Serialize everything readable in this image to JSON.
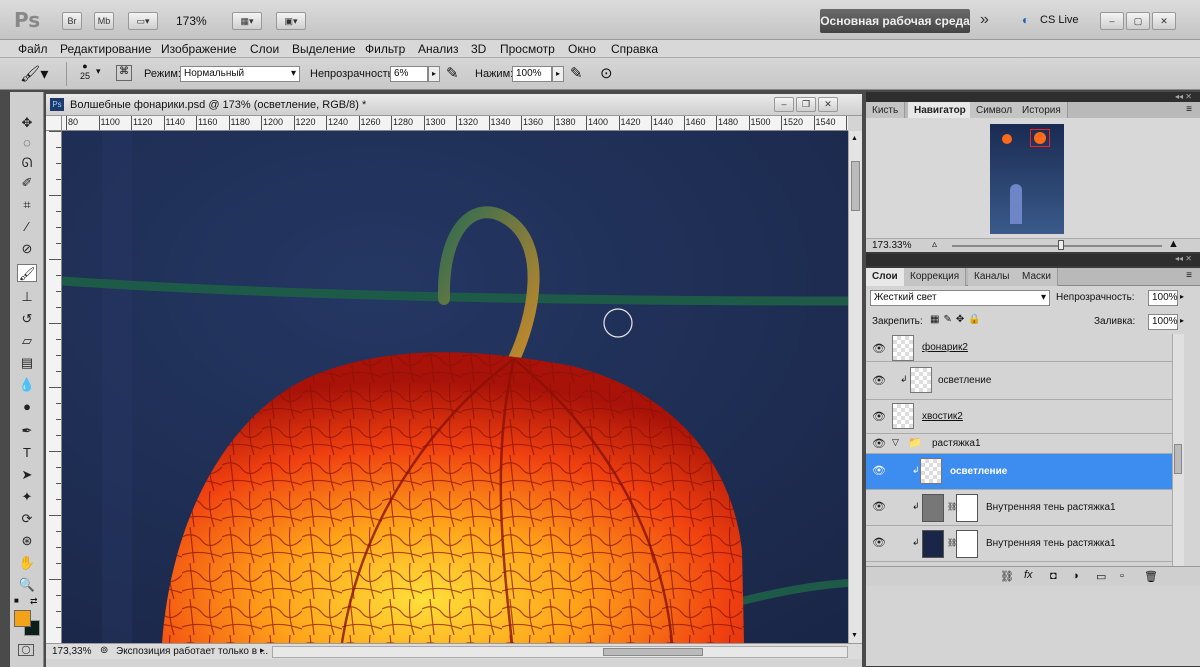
{
  "app": {
    "logo": "Ps",
    "bridge_btn": "Br",
    "minibridge_btn": "Mb",
    "zoom": "173%",
    "workspace": "Основная рабочая среда",
    "cs_live": "CS Live"
  },
  "menu": [
    "Файл",
    "Редактирование",
    "Изображение",
    "Слои",
    "Выделение",
    "Фильтр",
    "Анализ",
    "3D",
    "Просмотр",
    "Окно",
    "Справка"
  ],
  "options": {
    "brush_size": "25",
    "mode_label": "Режим:",
    "mode_value": "Нормальный",
    "opacity_label": "Непрозрачность:",
    "opacity_value": "6%",
    "flow_label": "Нажим:",
    "flow_value": "100%"
  },
  "document": {
    "title": "Волшебные фонарики.psd @ 173% (осветление, RGB/8) *",
    "ruler_ticks": [
      "80",
      "1100",
      "1120",
      "1140",
      "1160",
      "1180",
      "1200",
      "1220",
      "1240",
      "1260",
      "1280",
      "1300",
      "1320",
      "1340",
      "1360",
      "1380",
      "1400",
      "1420",
      "1440",
      "1460",
      "1480",
      "1500",
      "1520",
      "1540",
      "1560"
    ],
    "status_zoom": "173,33%",
    "status_text": "Экспозиция работает только в ..."
  },
  "navigator": {
    "tabs": [
      "Кисть",
      "Навигатор",
      "Символ",
      "История"
    ],
    "active_tab": "Навигатор",
    "zoom": "173.33%"
  },
  "layers": {
    "tabs": [
      "Слои",
      "Коррекция",
      "Каналы",
      "Маски"
    ],
    "active_tab": "Слои",
    "blend_mode": "Жесткий свет",
    "opacity_label": "Непрозрачность:",
    "opacity_value": "100%",
    "lock_label": "Закрепить:",
    "fill_label": "Заливка:",
    "fill_value": "100%",
    "rows": [
      {
        "name": "фонарик2"
      },
      {
        "name": "осветление"
      },
      {
        "name": "хвостик2"
      },
      {
        "name": "растяжка1"
      },
      {
        "name": "осветление"
      },
      {
        "name": "Внутренняя тень растяжка1"
      },
      {
        "name": "Внутренняя тень растяжка1"
      }
    ]
  },
  "colors": {
    "foreground": "#f2a31a",
    "background": "#0e1f1a",
    "selection": "#3d8cf0"
  }
}
